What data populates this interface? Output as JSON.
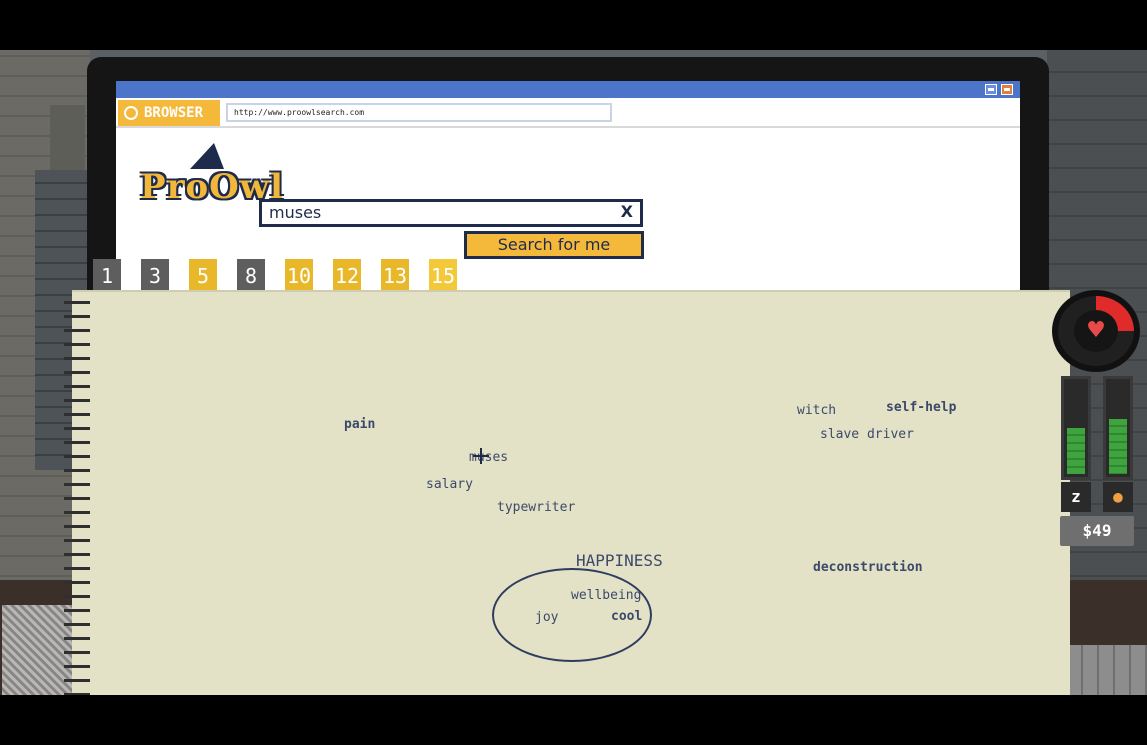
{
  "browser": {
    "label": "BROWSER",
    "url": "http://www.proowlsearch.com",
    "logo_text": "ProOwl",
    "search_value": "muses",
    "clear_label": "X",
    "search_button": "Search for me"
  },
  "tabs": [
    {
      "label": "1",
      "color": "grey"
    },
    {
      "label": "3",
      "color": "grey"
    },
    {
      "label": "5",
      "color": "yellow"
    },
    {
      "label": "8",
      "color": "grey"
    },
    {
      "label": "10",
      "color": "yellow"
    },
    {
      "label": "12",
      "color": "yellow"
    },
    {
      "label": "13",
      "color": "yellow"
    },
    {
      "label": "15",
      "color": "yellow",
      "active": true
    }
  ],
  "words": {
    "pain": "pain",
    "muses": "muses",
    "salary": "salary",
    "typewriter": "typewriter",
    "witch": "witch",
    "self_help": "self-help",
    "slave_driver": "slave driver",
    "happiness": "HAPPINESS",
    "wellbeing": "wellbeing",
    "joy": "joy",
    "cool": "cool",
    "deconstruction": "deconstruction"
  },
  "status": {
    "health_fraction": 0.25,
    "sleep_fraction": 0.5,
    "food_fraction": 0.6,
    "sleep_icon": "zz-icon",
    "food_icon": "drumstick-icon",
    "money": "$49"
  },
  "colors": {
    "accent": "#f4b93a",
    "ink": "#3c4a6a",
    "titlebar": "#4c74c9"
  }
}
